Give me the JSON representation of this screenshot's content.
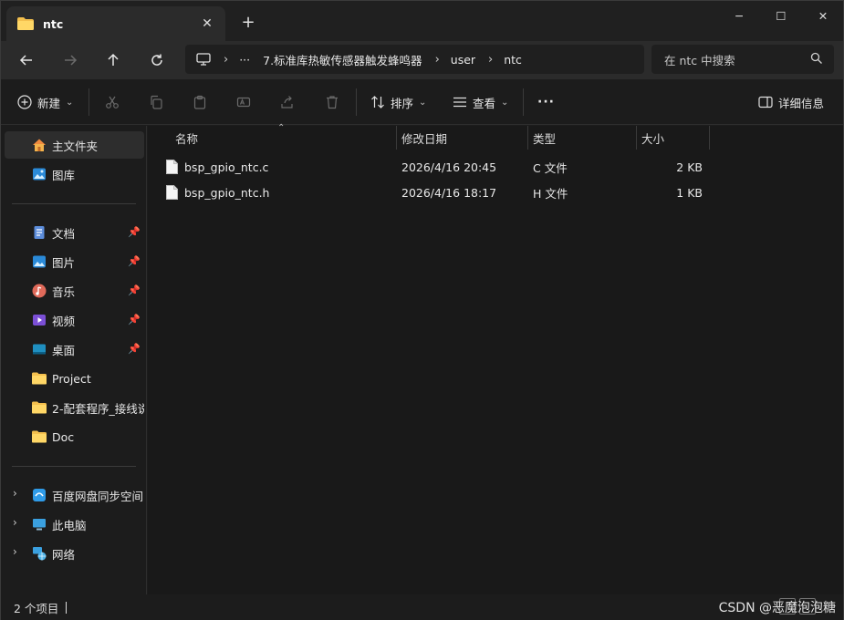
{
  "tab": {
    "title": "ntc",
    "close_glyph": "✕",
    "new_tab_glyph": "+"
  },
  "window_controls": {
    "minimize": "─",
    "maximize": "☐",
    "close": "✕"
  },
  "nav": {
    "back": "←",
    "forward": "→",
    "up": "↑",
    "refresh": "↻"
  },
  "breadcrumb": {
    "more": "···",
    "items": [
      "7.标准库热敏传感器触发蜂鸣器",
      "user",
      "ntc"
    ],
    "separator": "›"
  },
  "search": {
    "placeholder": "在 ntc 中搜索"
  },
  "toolbar": {
    "new_label": "新建",
    "sort_label": "排序",
    "view_label": "查看",
    "more_label": "···",
    "details_label": "详细信息"
  },
  "sidebar": {
    "home": "主文件夹",
    "gallery": "图库",
    "quick": [
      "文档",
      "图片",
      "音乐",
      "视频",
      "桌面",
      "Project",
      "2-配套程序_接线说",
      "Doc"
    ],
    "locations": [
      "百度网盘同步空间",
      "此电脑",
      "网络"
    ]
  },
  "columns": {
    "name": "名称",
    "modified": "修改日期",
    "type": "类型",
    "size": "大小"
  },
  "files": [
    {
      "name": "bsp_gpio_ntc.c",
      "modified": "2026/4/16 20:45",
      "type": "C 文件",
      "size": "2 KB"
    },
    {
      "name": "bsp_gpio_ntc.h",
      "modified": "2026/4/16 18:17",
      "type": "H 文件",
      "size": "1 KB"
    }
  ],
  "status": {
    "item_count": "2 个项目"
  },
  "watermark": "CSDN @恶魔泡泡糖",
  "colors": {
    "accent": "#4cc2ff",
    "folder": "#f4c04e",
    "background": "#1c1c1c"
  }
}
